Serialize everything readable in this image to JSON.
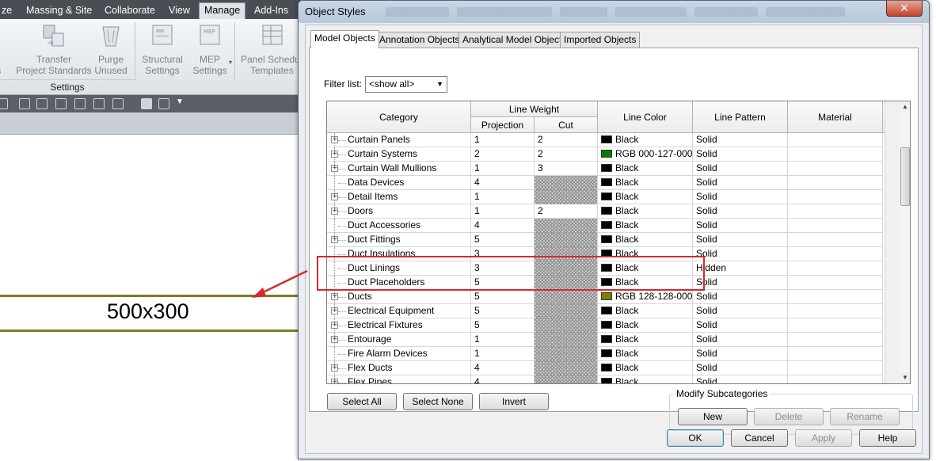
{
  "revit": {
    "tabs": [
      "ze",
      "Massing & Site",
      "Collaborate",
      "View",
      "Manage",
      "Add-Ins"
    ],
    "active_tab": "Manage",
    "ribbon": {
      "partial_left_1": "d",
      "partial_left_2": "ers",
      "transfer_line1": "Transfer",
      "transfer_line2": "Project Standards",
      "purge_line1": "Purge",
      "purge_line2": "Unused",
      "structural_line1": "Structural",
      "structural_line2": "Settings",
      "mep_line1": "MEP",
      "mep_line2": "Settings",
      "panel_line1": "Panel Schedu",
      "panel_line2": "Templates",
      "panel_label": "Settings"
    },
    "duct_label": "500x300",
    "duct_color": "#807a22"
  },
  "dialog": {
    "title": "Object Styles",
    "close_label": "✕",
    "tabs": [
      "Model Objects",
      "Annotation Objects",
      "Analytical Model Objects",
      "Imported Objects"
    ],
    "active_tab": "Model Objects",
    "filter_label": "Filter list:",
    "filter_value": "<show all>",
    "columns": {
      "category": "Category",
      "line_weight": "Line Weight",
      "projection": "Projection",
      "cut": "Cut",
      "line_color": "Line Color",
      "line_pattern": "Line Pattern",
      "material": "Material"
    },
    "rows": [
      {
        "category": "Curtain Panels",
        "expandable": true,
        "projection": "1",
        "cut": "2",
        "color": "Black",
        "swatch": "#000000",
        "pattern": "Solid",
        "material": ""
      },
      {
        "category": "Curtain Systems",
        "expandable": true,
        "projection": "2",
        "cut": "2",
        "color": "RGB 000-127-000",
        "swatch": "#007f00",
        "pattern": "Solid",
        "material": ""
      },
      {
        "category": "Curtain Wall Mullions",
        "expandable": true,
        "projection": "1",
        "cut": "3",
        "color": "Black",
        "swatch": "#000000",
        "pattern": "Solid",
        "material": ""
      },
      {
        "category": "Data Devices",
        "expandable": false,
        "projection": "4",
        "cut": null,
        "color": "Black",
        "swatch": "#000000",
        "pattern": "Solid",
        "material": ""
      },
      {
        "category": "Detail Items",
        "expandable": true,
        "projection": "1",
        "cut": null,
        "color": "Black",
        "swatch": "#000000",
        "pattern": "Solid",
        "material": ""
      },
      {
        "category": "Doors",
        "expandable": true,
        "projection": "1",
        "cut": "2",
        "color": "Black",
        "swatch": "#000000",
        "pattern": "Solid",
        "material": ""
      },
      {
        "category": "Duct Accessories",
        "expandable": false,
        "projection": "4",
        "cut": null,
        "color": "Black",
        "swatch": "#000000",
        "pattern": "Solid",
        "material": ""
      },
      {
        "category": "Duct Fittings",
        "expandable": true,
        "projection": "5",
        "cut": null,
        "color": "Black",
        "swatch": "#000000",
        "pattern": "Solid",
        "material": ""
      },
      {
        "category": "Duct Insulations",
        "expandable": false,
        "projection": "3",
        "cut": null,
        "color": "Black",
        "swatch": "#000000",
        "pattern": "Solid",
        "material": ""
      },
      {
        "category": "Duct Linings",
        "expandable": false,
        "projection": "3",
        "cut": null,
        "color": "Black",
        "swatch": "#000000",
        "pattern": "Hidden",
        "material": ""
      },
      {
        "category": "Duct Placeholders",
        "expandable": false,
        "projection": "5",
        "cut": null,
        "color": "Black",
        "swatch": "#000000",
        "pattern": "Solid",
        "material": ""
      },
      {
        "category": "Ducts",
        "expandable": true,
        "projection": "5",
        "cut": null,
        "color": "RGB 128-128-000",
        "swatch": "#807f00",
        "pattern": "Solid",
        "material": ""
      },
      {
        "category": "Electrical Equipment",
        "expandable": true,
        "projection": "5",
        "cut": null,
        "color": "Black",
        "swatch": "#000000",
        "pattern": "Solid",
        "material": ""
      },
      {
        "category": "Electrical Fixtures",
        "expandable": true,
        "projection": "5",
        "cut": null,
        "color": "Black",
        "swatch": "#000000",
        "pattern": "Solid",
        "material": ""
      },
      {
        "category": "Entourage",
        "expandable": true,
        "projection": "1",
        "cut": null,
        "color": "Black",
        "swatch": "#000000",
        "pattern": "Solid",
        "material": ""
      },
      {
        "category": "Fire Alarm Devices",
        "expandable": false,
        "projection": "1",
        "cut": null,
        "color": "Black",
        "swatch": "#000000",
        "pattern": "Solid",
        "material": ""
      },
      {
        "category": "Flex Ducts",
        "expandable": true,
        "projection": "4",
        "cut": null,
        "color": "Black",
        "swatch": "#000000",
        "pattern": "Solid",
        "material": ""
      },
      {
        "category": "Flex Pipes",
        "expandable": true,
        "projection": "4",
        "cut": null,
        "color": "Black",
        "swatch": "#000000",
        "pattern": "Solid",
        "material": ""
      }
    ],
    "buttons": {
      "select_all": "Select All",
      "select_none": "Select None",
      "invert": "Invert",
      "modify_group": "Modify Subcategories",
      "new": "New",
      "delete": "Delete",
      "rename": "Rename",
      "ok": "OK",
      "cancel": "Cancel",
      "apply": "Apply",
      "help": "Help"
    },
    "highlight_color": "#d92828"
  }
}
